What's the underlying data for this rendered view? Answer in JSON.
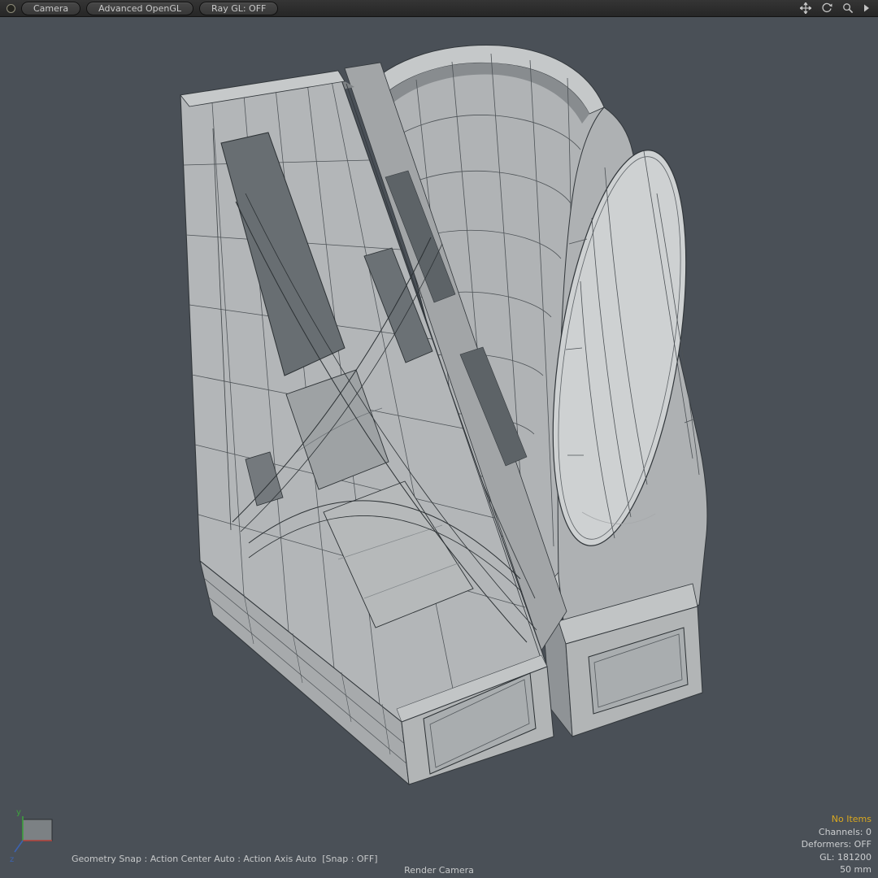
{
  "toolbar": {
    "buttons": {
      "camera": "Camera",
      "shading": "Advanced OpenGL",
      "raygl": "Ray GL: OFF"
    },
    "icons": [
      "pan-tool",
      "orbit-tool",
      "zoom-tool",
      "toolbar-expand"
    ]
  },
  "status_bar": {
    "snap_info": "Geometry Snap : Action Center Auto : Action Axis Auto  [Snap : OFF]",
    "camera_name": "Render Camera"
  },
  "info_overlay": {
    "selection": "No Items",
    "channels": "Channels: 0",
    "deformers": "Deformers: OFF",
    "gl_count": "GL: 181200",
    "focal_length": "50 mm"
  },
  "axis_gizmo": {
    "y_label": "y",
    "z_label": "z"
  },
  "colors": {
    "viewport_bg": "#4a5057",
    "toolbar_bg": "#2b2b2b",
    "selection_highlight": "#d9a81f",
    "ui_text": "#c9cbcc",
    "wireframe": "#31363a",
    "surface": "#b3b6b8"
  }
}
